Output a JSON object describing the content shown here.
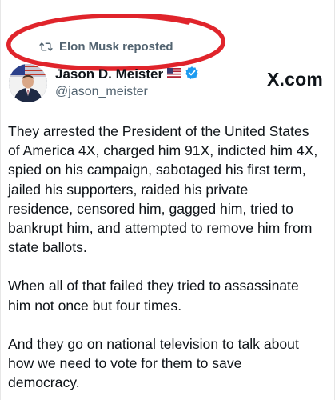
{
  "repost": {
    "label": "Elon Musk reposted"
  },
  "author": {
    "display_name": "Jason D. Meister",
    "handle": "@jason_meister",
    "flag_icon": "us-flag-icon",
    "verified_icon": "verified-badge-icon",
    "verified_color": "#1d9bf0"
  },
  "brand": {
    "label": "X.com"
  },
  "tweet": {
    "paragraphs": [
      {
        "lines": [
          "They arrested the President of the United States",
          "of America 4X, charged him 91X, indicted him 4X,",
          "spied on his campaign, sabotaged his first term,",
          "jailed his supporters, raided his private",
          "residence, censored him, gagged him, tried to",
          "bankrupt him, and attempted to remove him from",
          "state ballots."
        ]
      },
      {
        "lines": [
          "When all of that failed they tried to assassinate",
          "him not once but four times."
        ]
      },
      {
        "lines": [
          "And they go on national television to talk about",
          "how we need to vote for them to save",
          "democracy."
        ]
      }
    ]
  },
  "colors": {
    "text": "#0f1419",
    "secondary_text": "#536471",
    "annotation_ring": "#e0242b"
  }
}
